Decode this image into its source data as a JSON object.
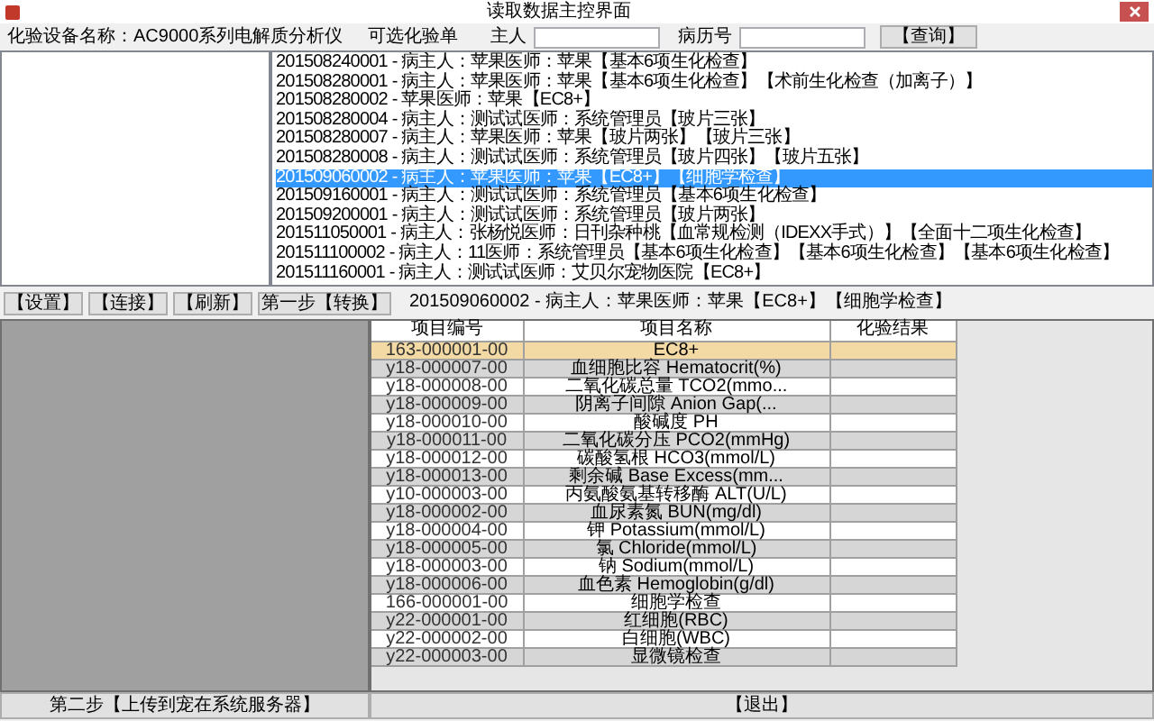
{
  "window": {
    "title": "读取数据主控界面"
  },
  "device": {
    "label": "化验设备名称：",
    "value": "AC9000系列电解质分析仪"
  },
  "filter": {
    "list_label": "可选化验单",
    "owner_label": "主人",
    "record_label": "病历号",
    "query_button": "【查询】"
  },
  "orders": [
    {
      "text": "201508240001 - 病主人：苹果医师：苹果【基本6项生化检查】",
      "selected": false
    },
    {
      "text": "201508280001 - 病主人：苹果医师：苹果【基本6项生化检查】【术前生化检查（加离子）】",
      "selected": false
    },
    {
      "text": "201508280002 - 苹果医师：苹果【EC8+】",
      "selected": false
    },
    {
      "text": "201508280004 - 病主人：测试试医师：系统管理员【玻片三张】",
      "selected": false
    },
    {
      "text": "201508280007 - 病主人：苹果医师：苹果【玻片两张】【玻片三张】",
      "selected": false
    },
    {
      "text": "201508280008 - 病主人：测试试医师：系统管理员【玻片四张】【玻片五张】",
      "selected": false
    },
    {
      "text": "201509060002 - 病主人：苹果医师：苹果【EC8+】【细胞学检查】",
      "selected": true
    },
    {
      "text": "201509160001 - 病主人：测试试医师：系统管理员【基本6项生化检查】",
      "selected": false
    },
    {
      "text": "201509200001 - 病主人：测试试医师：系统管理员【玻片两张】",
      "selected": false
    },
    {
      "text": "201511050001 - 病主人：张杨悦医师：日刊杂种桃【血常规检测（IDEXX手式）】【全面十二项生化检查】",
      "selected": false
    },
    {
      "text": "201511100002 - 病主人：11医师：系统管理员【基本6项生化检查】【基本6项生化检查】【基本6项生化检查】",
      "selected": false
    },
    {
      "text": "201511160001 - 病主人：测试试医师：艾贝尔宠物医院【EC8+】",
      "selected": false
    }
  ],
  "buttons": [
    "【设置】",
    "【连接】",
    "【刷新】",
    "第一步【转换】"
  ],
  "order_info": "201509060002 - 病主人：苹果医师：苹果【EC8+】【细胞学检查】",
  "table": {
    "columns": [
      "项目编号",
      "项目名称",
      "化验结果"
    ],
    "rows": [
      {
        "code": "163-000001-00",
        "name": "EC8+",
        "selected": true
      },
      {
        "code": "y18-000007-00",
        "name": "血细胞比容 Hematocrit(%)",
        "selected": false
      },
      {
        "code": "y18-000008-00",
        "name": "二氧化碳总量 TCO2(mmo...",
        "selected": false
      },
      {
        "code": "y18-000009-00",
        "name": "阴离子间隙 Anion Gap(...",
        "selected": false
      },
      {
        "code": "y18-000010-00",
        "name": "酸碱度 PH",
        "selected": false
      },
      {
        "code": "y18-000011-00",
        "name": "二氧化碳分压 PCO2(mmHg)",
        "selected": false
      },
      {
        "code": "y18-000012-00",
        "name": "碳酸氢根 HCO3(mmol/L)",
        "selected": false
      },
      {
        "code": "y18-000013-00",
        "name": "剩余碱 Base Excess(mm...",
        "selected": false
      },
      {
        "code": "y10-000003-00",
        "name": "丙氨酸氨基转移酶 ALT(U/L)",
        "selected": false
      },
      {
        "code": "y18-000002-00",
        "name": "血尿素氮 BUN(mg/dl)",
        "selected": false
      },
      {
        "code": "y18-000004-00",
        "name": "钾 Potassium(mmol/L)",
        "selected": false
      },
      {
        "code": "y18-000005-00",
        "name": "氯 Chloride(mmol/L)",
        "selected": false
      },
      {
        "code": "y18-000003-00",
        "name": "钠 Sodium(mmol/L)",
        "selected": false
      },
      {
        "code": "y18-000006-00",
        "name": "血色素 Hemoglobin(g/dl)",
        "selected": false
      },
      {
        "code": "166-000001-00",
        "name": "细胞学检查",
        "selected": false
      },
      {
        "code": "y22-000001-00",
        "name": "红细胞(RBC)",
        "selected": false
      },
      {
        "code": "y22-000002-00",
        "name": "白细胞(WBC)",
        "selected": false
      },
      {
        "code": "y22-000003-00",
        "name": "显微镜检查",
        "selected": false
      }
    ]
  },
  "bottom_buttons": [
    "第二步【上传到宠在系统服务器】",
    "【退出】"
  ]
}
